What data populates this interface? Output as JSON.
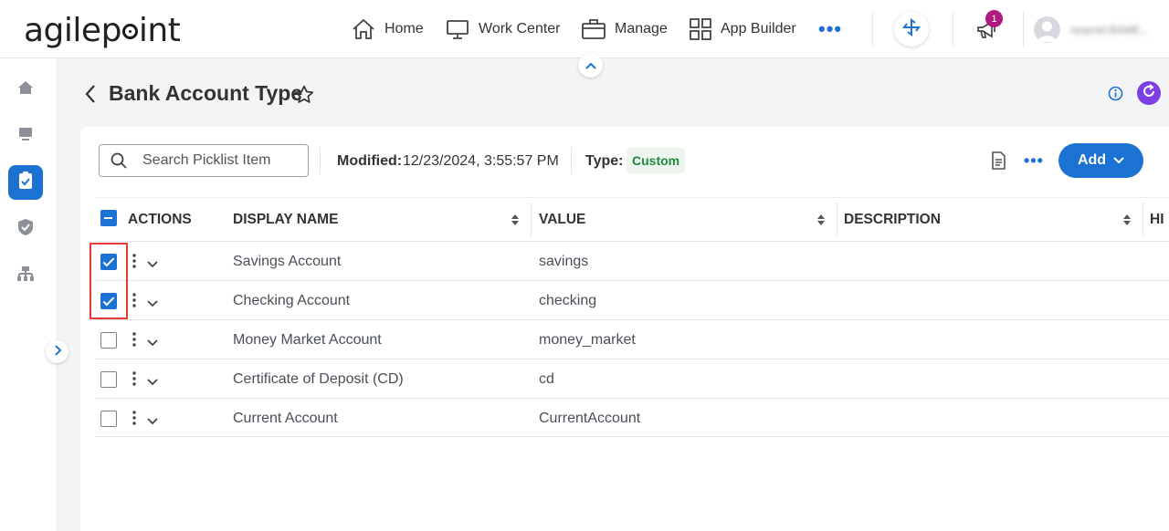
{
  "header": {
    "nav": [
      {
        "label": "Home",
        "icon": "home-icon"
      },
      {
        "label": "Work Center",
        "icon": "monitor-icon"
      },
      {
        "label": "Manage",
        "icon": "briefcase-icon"
      },
      {
        "label": "App Builder",
        "icon": "grid-icon"
      }
    ],
    "more": "•••",
    "notification_count": "1",
    "username": "neamel.BAME..."
  },
  "page": {
    "title": "Bank Account Type"
  },
  "toolbar": {
    "search_placeholder": "Search Picklist Item",
    "modified_label": "Modified:",
    "modified_value": "12/23/2024, 3:55:57 PM",
    "type_label": "Type:",
    "type_value": "Custom",
    "add_label": "Add"
  },
  "table": {
    "columns": [
      "ACTIONS",
      "DISPLAY NAME",
      "VALUE",
      "DESCRIPTION",
      "HI"
    ],
    "rows": [
      {
        "display_name": "Savings Account",
        "value": "savings",
        "checked": true
      },
      {
        "display_name": "Checking Account",
        "value": "checking",
        "checked": true
      },
      {
        "display_name": "Money Market Account",
        "value": "money_market",
        "checked": false
      },
      {
        "display_name": "Certificate of Deposit (CD)",
        "value": "cd",
        "checked": false
      },
      {
        "display_name": "Current Account",
        "value": "CurrentAccount",
        "checked": false
      }
    ]
  },
  "colors": {
    "primary": "#1c72d2",
    "type_badge_bg": "#edf6ee",
    "type_badge_text": "#218a3c",
    "notification": "#b0197e",
    "refresh": "#7b3fe4",
    "highlight": "#e53935"
  }
}
